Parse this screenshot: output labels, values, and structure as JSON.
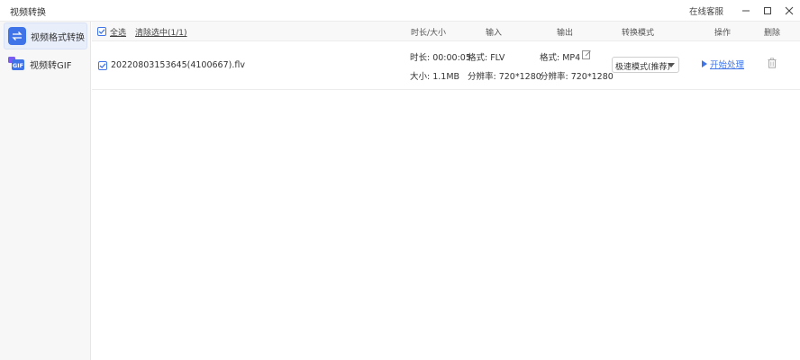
{
  "app": {
    "title": "视频转换"
  },
  "window": {
    "support_label": "在线客服"
  },
  "sidebar": {
    "items": [
      {
        "label": "视频格式转换",
        "icon": "convert-arrows-icon",
        "active": true
      },
      {
        "label": "视频转GIF",
        "icon": "gif-icon",
        "active": false
      }
    ]
  },
  "toolbar": {
    "select_all": "全选",
    "clear_selection": "清除选中(1/1)"
  },
  "table": {
    "columns": {
      "duration_size": "时长/大小",
      "input": "输入",
      "output": "输出",
      "mode": "转换模式",
      "action": "操作",
      "delete": "删除"
    },
    "rows": [
      {
        "checked": true,
        "filename": "20220803153645(4100667).flv",
        "duration": "时长: 00:00:05",
        "size": "大小: 1.1MB",
        "input_format": "格式: FLV",
        "input_resolution": "分辨率: 720*1280",
        "output_format": "格式: MP4",
        "output_resolution": "分辨率: 720*1280",
        "mode": "极速模式(推荐)",
        "action": "开始处理"
      }
    ]
  },
  "colors": {
    "accent": "#3f74e8"
  }
}
